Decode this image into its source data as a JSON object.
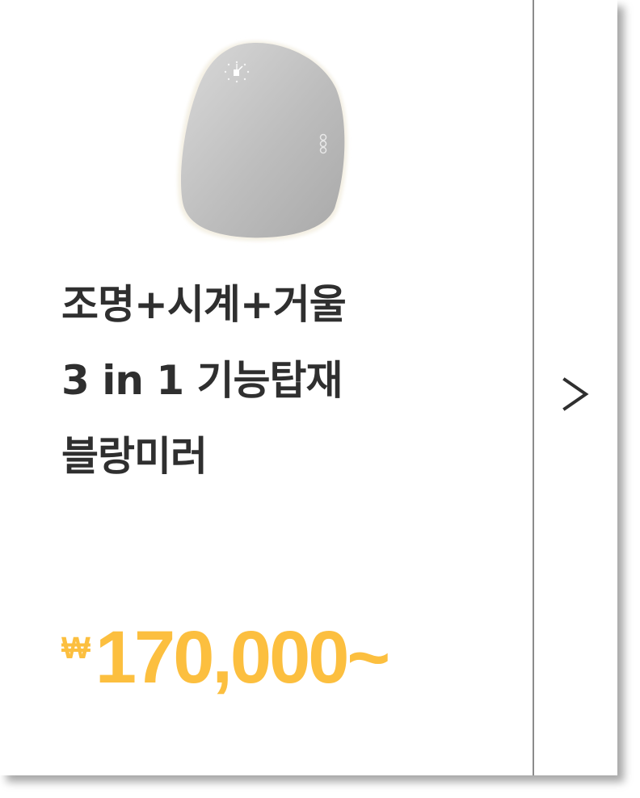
{
  "product": {
    "image_icon": "round-mirror-with-clock-icon",
    "title_lines": [
      "조명+시계+거울",
      "3 in 1 기능탑재",
      "블랑미러"
    ],
    "currency_symbol": "₩",
    "price": "170,000~"
  },
  "navigation": {
    "next_icon": "chevron-right-icon"
  },
  "colors": {
    "price": "#fcbf3f",
    "title": "#2f2f2f",
    "divider": "#8c8c8c"
  }
}
